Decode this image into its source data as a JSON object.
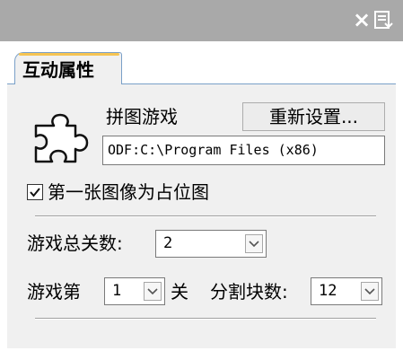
{
  "titlebar": {
    "close_glyph": "×",
    "close_icon": "close-icon",
    "menu_icon": "panel-menu-icon",
    "background": "#a9a9a9"
  },
  "tabs": [
    {
      "label": "互动属性",
      "active": true
    }
  ],
  "game": {
    "icon": "puzzle-icon",
    "title": "拼图游戏",
    "reset_button_label": "重新设置...",
    "image_path": "ODF:C:\\Program Files (x86)"
  },
  "first_image_placeholder": {
    "label": "第一张图像为占位图",
    "checked": true
  },
  "levels": {
    "total_label": "游戏总关数:",
    "total_value": "2",
    "level_prefix": "游戏第",
    "level_value": "1",
    "level_suffix": "关",
    "pieces_label": "分割块数:",
    "pieces_value": "12"
  },
  "colors": {
    "tab_border": "#7aa0c8",
    "tab_accent": "#f5c453",
    "panel_bg": "#f0f0f0"
  }
}
